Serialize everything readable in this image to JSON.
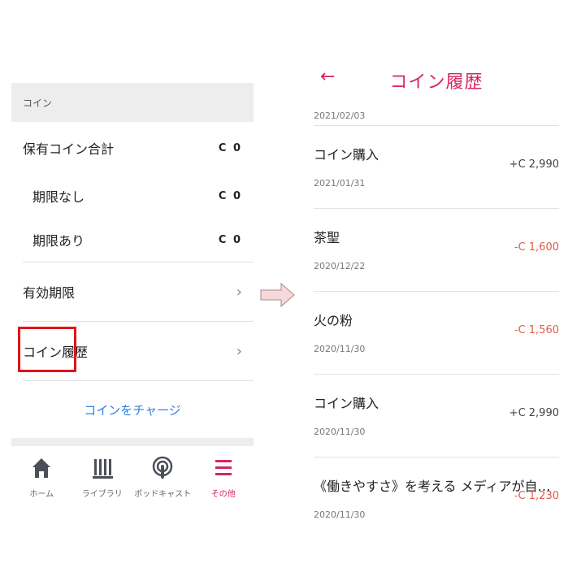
{
  "left": {
    "section_label": "コイン",
    "total_label": "保有コイン合計",
    "total_value": "C 0",
    "no_limit_label": "期限なし",
    "no_limit_value": "C 0",
    "limit_label": "期限あり",
    "limit_value": "C 0",
    "expiry_label": "有効期限",
    "history_label": "コイン履歴",
    "charge_label": "コインをチャージ"
  },
  "tabs": [
    {
      "label": "ホーム",
      "icon": "home-icon"
    },
    {
      "label": "ライブラリ",
      "icon": "library-icon"
    },
    {
      "label": "ポッドキャスト",
      "icon": "podcast-icon"
    },
    {
      "label": "その他",
      "icon": "menu-icon",
      "active": true
    }
  ],
  "right": {
    "title": "コイン履歴",
    "top_date": "2021/02/03",
    "items": [
      {
        "name": "コイン購入",
        "date": "2021/01/31",
        "amount": "+C 2,990"
      },
      {
        "name": "茶聖",
        "date": "2020/12/22",
        "amount": "-C 1,600"
      },
      {
        "name": "火の粉",
        "date": "2020/11/30",
        "amount": "-C 1,560"
      },
      {
        "name": "コイン購入",
        "date": "2020/11/30",
        "amount": "+C 2,990"
      },
      {
        "name": "《働きやすさ》を考える メディアが自…",
        "date": "2020/11/30",
        "amount": "-C 1,230"
      }
    ]
  },
  "colors": {
    "accent": "#d6265c",
    "link": "#2f7fe0",
    "highlight_box": "#e0141c",
    "negative": "#e35a4a"
  }
}
